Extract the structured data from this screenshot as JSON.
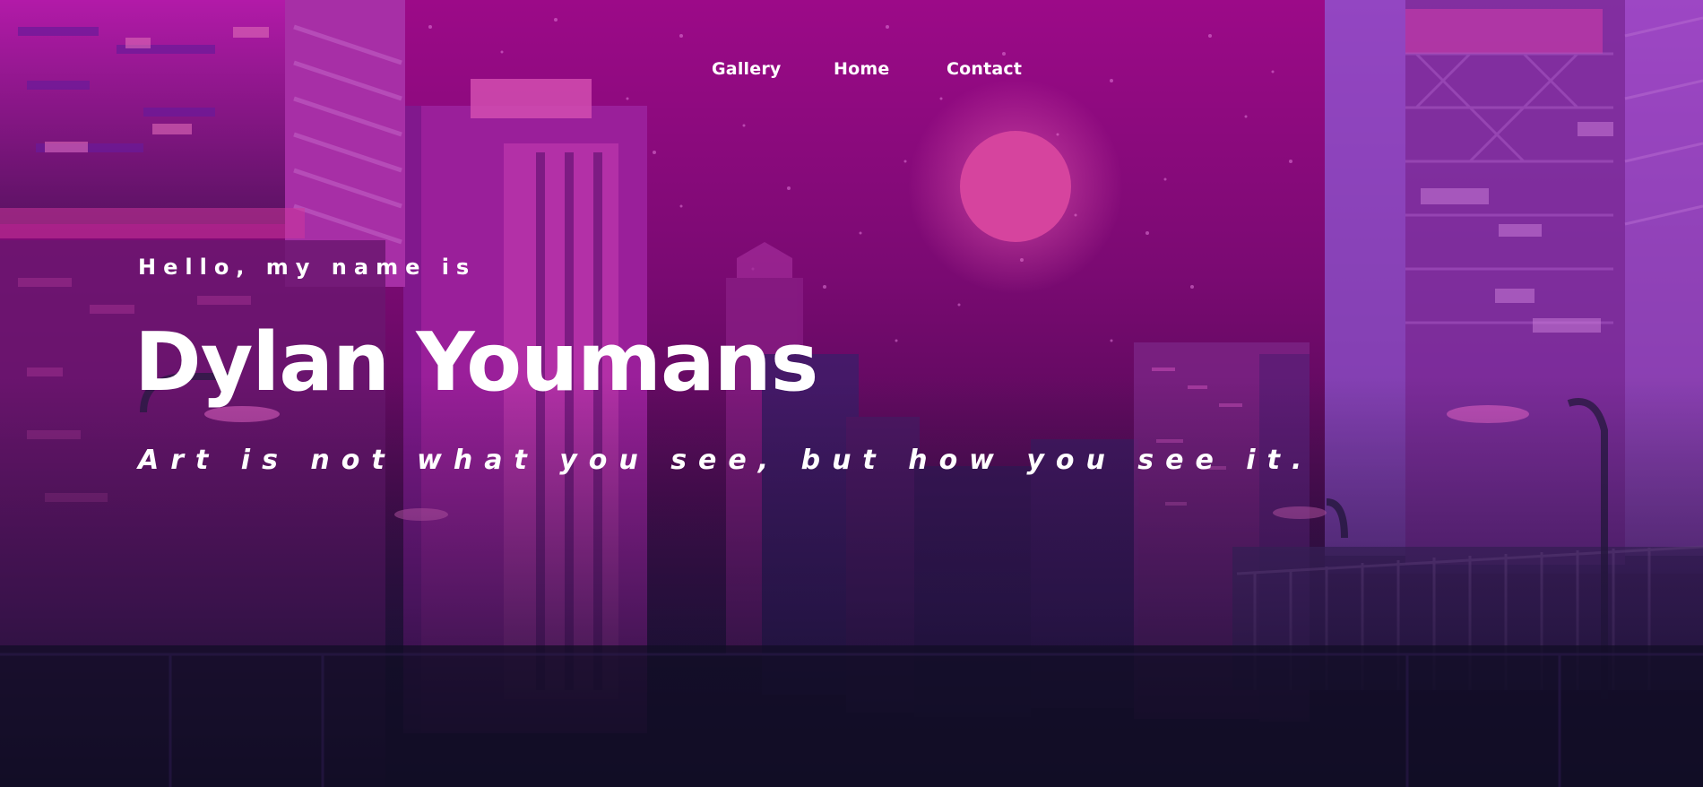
{
  "nav": {
    "items": [
      {
        "label": "Gallery"
      },
      {
        "label": "Home"
      },
      {
        "label": "Contact"
      }
    ]
  },
  "hero": {
    "intro": "Hello, my name is",
    "name": "Dylan Youmans",
    "tagline": "Art is not what you see, but how you see it."
  },
  "colors": {
    "sky_top": "#9a0a86",
    "sky_mid": "#6d0a68",
    "ground": "#140f2a",
    "moon": "#e04aa8",
    "text": "#ffffff"
  }
}
